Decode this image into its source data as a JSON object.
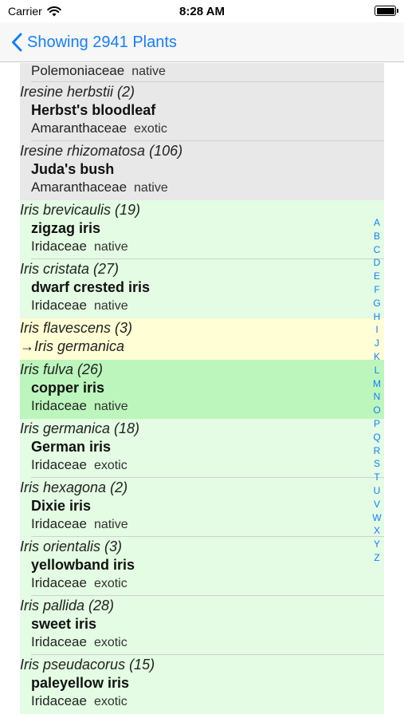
{
  "status_bar": {
    "carrier": "Carrier",
    "time": "8:28 AM"
  },
  "nav": {
    "back_label": "Showing 2941 Plants"
  },
  "colors": {
    "accent": "#157efb",
    "gray_row": "#e8e8e8",
    "green_row": "#e3fce3",
    "yellow_row": "#fffed5",
    "selected_row": "#bcf6bc"
  },
  "rows": [
    {
      "family": "Polemoniaceae",
      "status": "native"
    },
    {
      "sci": "Iresine herbstii  (2)",
      "common": "Herbst's bloodleaf",
      "family": "Amaranthaceae",
      "status": "exotic"
    },
    {
      "sci": "Iresine rhizomatosa  (106)",
      "common": "Juda's bush",
      "family": "Amaranthaceae",
      "status": "native"
    },
    {
      "sci": "Iris brevicaulis  (19)",
      "common": "zigzag iris",
      "family": "Iridaceae",
      "status": "native"
    },
    {
      "sci": "Iris cristata  (27)",
      "common": "dwarf crested iris",
      "family": "Iridaceae",
      "status": "native"
    },
    {
      "sci": "Iris flavescens  (3)",
      "synonym": "→Iris germanica"
    },
    {
      "sci": "Iris fulva  (26)",
      "common": "copper iris",
      "family": "Iridaceae",
      "status": "native"
    },
    {
      "sci": "Iris germanica  (18)",
      "common": "German iris",
      "family": "Iridaceae",
      "status": "exotic"
    },
    {
      "sci": "Iris hexagona  (2)",
      "common": "Dixie iris",
      "family": "Iridaceae",
      "status": "native"
    },
    {
      "sci": "Iris orientalis  (3)",
      "common": "yellowband iris",
      "family": "Iridaceae",
      "status": "exotic"
    },
    {
      "sci": "Iris pallida  (28)",
      "common": "sweet iris",
      "family": "Iridaceae",
      "status": "exotic"
    },
    {
      "sci": "Iris pseudacorus  (15)",
      "common": "paleyellow iris",
      "family": "Iridaceae",
      "status": "exotic"
    }
  ],
  "index_letters": [
    "A",
    "B",
    "C",
    "D",
    "E",
    "F",
    "G",
    "H",
    "I",
    "J",
    "K",
    "L",
    "M",
    "N",
    "O",
    "P",
    "Q",
    "R",
    "S",
    "T",
    "U",
    "V",
    "W",
    "X",
    "Y",
    "Z"
  ]
}
